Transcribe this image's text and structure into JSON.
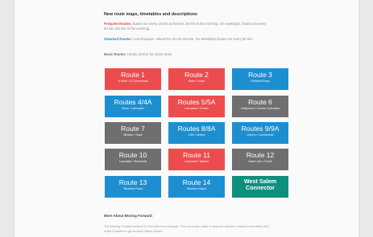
{
  "heading": "New route maps, timetables and descriptions",
  "frequent": {
    "label": "Frequent Routes:",
    "text": " Buses run every 15 min at busiest, 30 min in the morning. On weekdays, buses run every 30 min (45 min in the evening)."
  },
  "standard": {
    "label": "Standard Routes:",
    "text": " Less frequent—about the 30 min service. On Weekdays buses run every 60 min."
  },
  "basic": {
    "label": "Basic Routes:",
    "text": " Hourly service for entire route."
  },
  "routes": [
    {
      "name": "Route 1",
      "sub": "N Main / S Commercial"
    },
    {
      "name": "Route 2",
      "sub": "State / Union"
    },
    {
      "name": "Route 3",
      "sub": "Portland Road"
    },
    {
      "name": "Routes 4/4A",
      "sub": "Silver / Lancaster"
    },
    {
      "name": "Routes 5/5A",
      "sub": "Lancaster / Center"
    },
    {
      "name": "Route 6",
      "sub": "Hollywood / Cordon Suburban"
    },
    {
      "name": "Route 7",
      "sub": "Mission / State"
    },
    {
      "name": "Routes 8/8A",
      "sub": "13th / Liberty"
    },
    {
      "name": "Routes 9/9A",
      "sub": "Liberty / Commercial"
    },
    {
      "name": "Route 10",
      "sub": "Lancaster / Northeast"
    },
    {
      "name": "Route 11",
      "sub": "Lancaster / Market"
    },
    {
      "name": "Route 12",
      "sub": "Salem Ave / South"
    },
    {
      "name": "Route 13",
      "sub": "Silverton Road"
    },
    {
      "name": "Route 14",
      "sub": "Windsor Island"
    },
    {
      "name": "West Salem Connector",
      "sub": ""
    }
  ],
  "colors": {
    "frequent": "#ec4c4e",
    "standard": "#1d8fd1",
    "basic": "#6f6f6f",
    "connector": "#0e8f7e"
  },
  "more": {
    "title": "More About Moving Forward:",
    "text": "The Moving Forward project is Cherriots bus redesign. The work was made to improve service, reduce travel times and make it easier to get around Salem-Keizer."
  }
}
